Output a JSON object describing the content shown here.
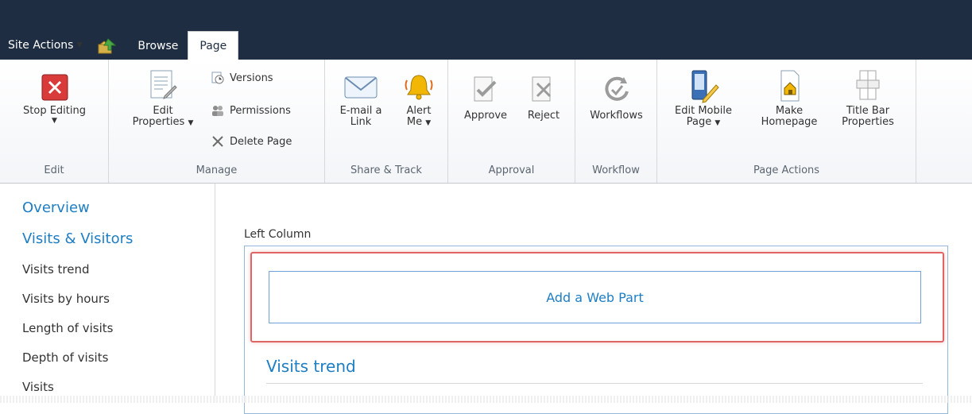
{
  "topbar": {
    "site_actions": "Site Actions",
    "tabs": [
      "Browse",
      "Page"
    ]
  },
  "ribbon": {
    "groups": {
      "edit": {
        "label": "Edit",
        "stop_editing": "Stop Editing"
      },
      "manage": {
        "label": "Manage",
        "edit_properties_line1": "Edit",
        "edit_properties_line2": "Properties",
        "versions": "Versions",
        "permissions": "Permissions",
        "delete_page": "Delete Page"
      },
      "share_track": {
        "label": "Share & Track",
        "email_line1": "E-mail a",
        "email_line2": "Link",
        "alert_line1": "Alert",
        "alert_line2": "Me"
      },
      "approval": {
        "label": "Approval",
        "approve": "Approve",
        "reject": "Reject"
      },
      "workflow": {
        "label": "Workflow",
        "workflows": "Workflows"
      },
      "page_actions": {
        "label": "Page Actions",
        "edit_mobile_line1": "Edit Mobile",
        "edit_mobile_line2": "Page",
        "make_home_line1": "Make",
        "make_home_line2": "Homepage",
        "title_bar_line1": "Title Bar",
        "title_bar_line2": "Properties"
      }
    }
  },
  "sidebar": {
    "items": [
      {
        "label": "Overview",
        "type": "heading"
      },
      {
        "label": "Visits & Visitors",
        "type": "heading"
      },
      {
        "label": "Visits trend",
        "type": "link"
      },
      {
        "label": "Visits by hours",
        "type": "link"
      },
      {
        "label": "Length of visits",
        "type": "link"
      },
      {
        "label": "Depth of visits",
        "type": "link"
      },
      {
        "label": "Visits",
        "type": "link"
      }
    ]
  },
  "content": {
    "left_column_label": "Left Column",
    "add_web_part": "Add a Web Part",
    "web_part_title": "Visits trend"
  },
  "colors": {
    "topbar_bg": "#1e2d42",
    "link_blue": "#1e7ec4",
    "highlight_red": "#e06666"
  }
}
